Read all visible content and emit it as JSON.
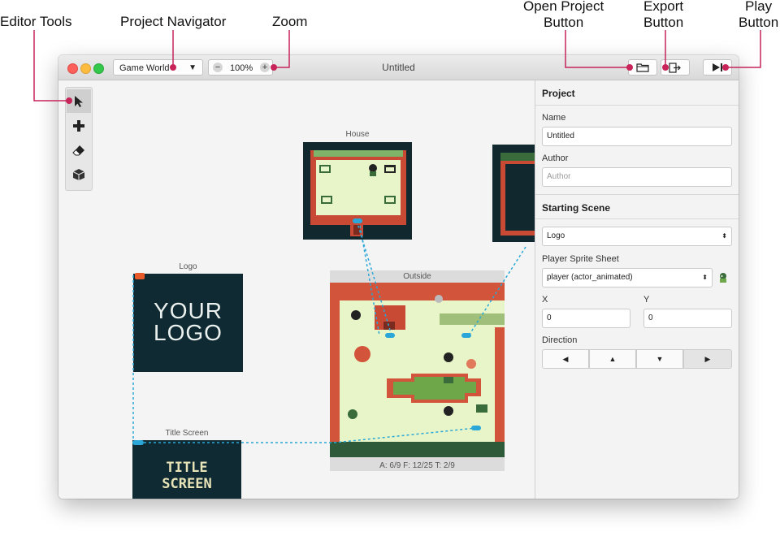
{
  "callouts": {
    "editor_tools": "Editor Tools",
    "project_navigator": "Project Navigator",
    "zoom": "Zoom",
    "open_project_l1": "Open Project",
    "open_project_l2": "Button",
    "export_l1": "Export",
    "export_l2": "Button",
    "play_l1": "Play",
    "play_l2": "Button"
  },
  "window": {
    "title": "Untitled",
    "project_select": "Game World",
    "project_select_arrow": "▼",
    "zoom_minus": "−",
    "zoom_value": "100%",
    "zoom_plus": "+",
    "open_icon": "folder-icon",
    "export_icon": "export-icon",
    "play_icon": "play-icon"
  },
  "tools": [
    {
      "name": "select-tool",
      "icon": "arrow-cursor-icon",
      "glyph": "➤"
    },
    {
      "name": "add-tool",
      "icon": "plus-icon",
      "glyph": "✚"
    },
    {
      "name": "eraser-tool",
      "icon": "eraser-icon",
      "glyph": "⌫"
    },
    {
      "name": "actor-tool",
      "icon": "cube-icon",
      "glyph": "▣"
    }
  ],
  "scenes": {
    "house": {
      "label": "House"
    },
    "logo": {
      "label": "Logo",
      "line1": "YOUR",
      "line2": "LOGO"
    },
    "outside": {
      "label": "Outside",
      "stats": "A: 6/9   F: 12/25   T: 2/9"
    },
    "title_screen": {
      "label": "Title Screen",
      "line1": "TITLE",
      "line2": "SCREEN"
    }
  },
  "sidebar": {
    "project_heading": "Project",
    "name_label": "Name",
    "name_value": "Untitled",
    "author_label": "Author",
    "author_placeholder": "Author",
    "starting_scene_heading": "Starting Scene",
    "starting_scene_value": "Logo",
    "sprite_label": "Player Sprite Sheet",
    "sprite_value": "player (actor_animated)",
    "select_arrow": "⬍",
    "x_label": "X",
    "x_value": "0",
    "y_label": "Y",
    "y_value": "0",
    "direction_label": "Direction",
    "directions": [
      "◀",
      "▲",
      "▼",
      "▶"
    ]
  },
  "colors": {
    "accent_callout": "#c7245a",
    "trigger": "#2aa7d8",
    "scene_dark": "#0f2a33",
    "grass": "#e8f5c8",
    "brick": "#d2543a"
  }
}
